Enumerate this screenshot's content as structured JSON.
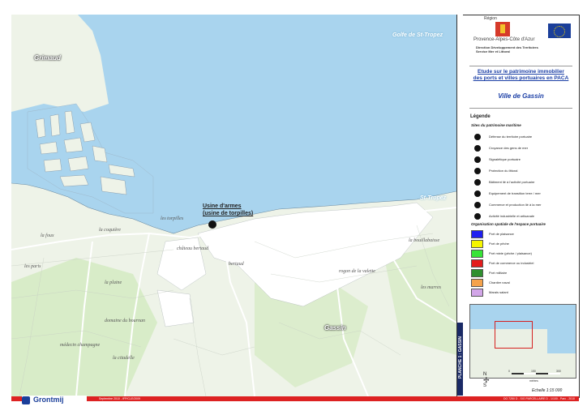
{
  "map": {
    "sea_labels": {
      "gulf": "Golfe de St-Tropez",
      "st_tropez": "St-Tropez"
    },
    "town_labels": {
      "grimaud": "Grimaud",
      "gassin": "Gassin"
    },
    "place_labels": [
      "les torpilles",
      "château bertaud",
      "bertaud",
      "la foux",
      "la bouillabaisse",
      "les marres",
      "les paris",
      "rogon de la valette",
      "la plaine",
      "domaine du bournan",
      "médecin champagne",
      "la citadelle",
      "la coquière"
    ],
    "callout": {
      "line1": "Usine d'armes",
      "line2": "(usine de torpilles)"
    }
  },
  "panel": {
    "region_name": "Région",
    "region_full": "Provence-Alpes-Côte d'Azur",
    "direction_line1": "Direction Développement des Territoires",
    "direction_line2": "Service Mer et Littoral",
    "study_title_line1": "Etude sur le patrimoine immobilier",
    "study_title_line2": "des ports et villes portuaires en PACA",
    "city_title": "Ville de Gassin",
    "legend_title": "Légende",
    "sites_title": "Sites du patrimoine maritime",
    "sites": [
      {
        "label": "Défense du territoire portuaire",
        "icon": "defense-icon"
      },
      {
        "label": "Croyance des gens de mer",
        "icon": "belief-icon"
      },
      {
        "label": "Signalétique portuaire",
        "icon": "signage-icon"
      },
      {
        "label": "Protection du littoral",
        "icon": "protection-icon"
      },
      {
        "label": "Bâtiment lié à l'activité portuaire",
        "icon": "building-icon"
      },
      {
        "label": "Equipement de transition terre / mer",
        "icon": "equipment-icon"
      },
      {
        "label": "Commerce et production lié à la mer",
        "icon": "commerce-icon"
      },
      {
        "label": "Activité industrielle et artisanale",
        "icon": "industry-icon"
      }
    ],
    "org_title": "Organisation spatiale de l'espace portuaire",
    "org_items": [
      {
        "label": "Port de plaisance",
        "color": "#1f1ff0"
      },
      {
        "label": "Port de pêche",
        "color": "#f6f600"
      },
      {
        "label": "Port mixte (pêche / plaisance)",
        "color": "#37e437"
      },
      {
        "label": "Port de commerce ou industriel",
        "color": "#e31c1c"
      },
      {
        "label": "Port militaire",
        "color": "#2f8f2f"
      },
      {
        "label": "Chantier naval",
        "color": "#f4a24b"
      },
      {
        "label": "Marais salant",
        "color": "#d2a6e8"
      }
    ],
    "scale_labels": {
      "zero": "0",
      "s150": "150",
      "s300": "300"
    },
    "scale_unit": "mètres",
    "echelle": "Echelle 1:15 000",
    "north": {
      "n": "N",
      "s": "S"
    }
  },
  "strip": {
    "planche": "PLANCHE 1 : GASSIN"
  },
  "footer": {
    "date": "Septembre 2010 - IFP/CLE/2009",
    "ref": "DO 7250 D - SIG PARCELLAIRE D - 1/100 - Parc - 2010"
  },
  "logo": {
    "name": "Grontmij"
  },
  "colors": {
    "sea": "#a9d4ee",
    "land": "#eef3e8",
    "urban": "#ffffff",
    "roads": "#ffffff",
    "title_blue": "#1b3fa6",
    "footer_red": "#d22222"
  }
}
